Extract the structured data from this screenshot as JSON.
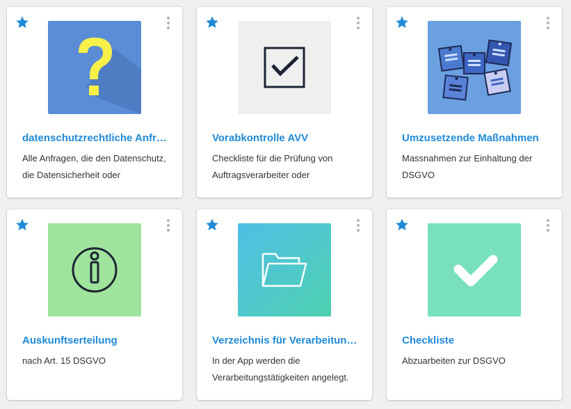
{
  "colors": {
    "accent": "#1f8ad6",
    "star": "#1f8ad6",
    "menu_dots": "#b0b4b9"
  },
  "cards": [
    {
      "title": "datenschutzrechtliche Anfr…",
      "description": "Alle Anfragen, die den Datenschutz, die Datensicherheit oder",
      "icon": "question-mark-icon",
      "tile_color": "#5b8dd6",
      "favorite": true
    },
    {
      "title": "Vorabkontrolle AVV",
      "description": "Checkliste für die Prüfung von Auftragsverarbeiter oder",
      "icon": "checkbox-icon",
      "tile_color": "#efefef",
      "favorite": true
    },
    {
      "title": "Umzusetzende Maßnahmen",
      "description": "Massnahmen zur Einhaltung der DSGVO",
      "icon": "sticky-notes-icon",
      "tile_color": "#6a9fe0",
      "favorite": true
    },
    {
      "title": "Auskunftserteilung",
      "description": "nach Art. 15 DSGVO",
      "icon": "info-icon",
      "tile_color": "#9fe39c",
      "favorite": true
    },
    {
      "title": "Verzeichnis für Verarbeitun…",
      "description": "In der App werden die Verarbeitungstätigkeiten angelegt.",
      "icon": "folder-icon",
      "tile_color": "#4cc7c9",
      "favorite": true
    },
    {
      "title": "Checkliste",
      "description": "Abzuarbeiten zur DSGVO",
      "icon": "checkmark-icon",
      "tile_color": "#78e0bf",
      "favorite": true
    }
  ]
}
